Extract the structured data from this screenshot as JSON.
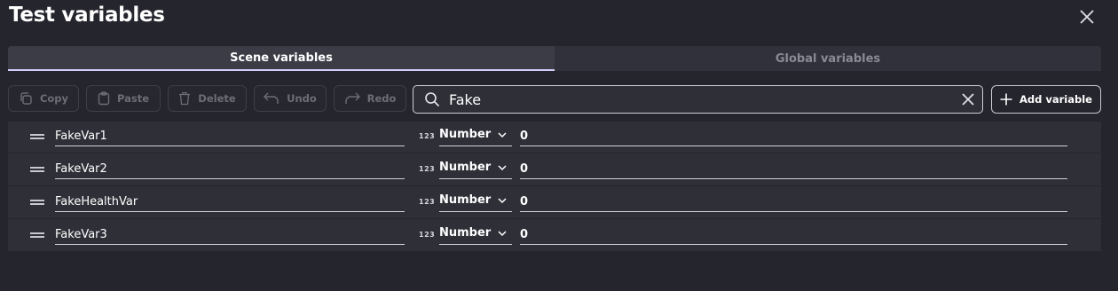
{
  "dialog": {
    "title": "Test variables"
  },
  "tabs": [
    {
      "label": "Scene variables",
      "active": true
    },
    {
      "label": "Global variables",
      "active": false
    }
  ],
  "toolbar": {
    "copy_label": "Copy",
    "paste_label": "Paste",
    "delete_label": "Delete",
    "undo_label": "Undo",
    "redo_label": "Redo",
    "add_label": "Add variable"
  },
  "search": {
    "value": "Fake"
  },
  "variables": [
    {
      "name": "FakeVar1",
      "type_icon": "123",
      "type": "Number",
      "value": "0"
    },
    {
      "name": "FakeVar2",
      "type_icon": "123",
      "type": "Number",
      "value": "0"
    },
    {
      "name": "FakeHealthVar",
      "type_icon": "123",
      "type": "Number",
      "value": "0"
    },
    {
      "name": "FakeVar3",
      "type_icon": "123",
      "type": "Number",
      "value": "0"
    }
  ],
  "colors": {
    "background": "#25252d",
    "panel": "#2f2f38",
    "tab_accent": "#d7cdfb",
    "disabled_text": "#6d6d78"
  },
  "icons": {
    "close": "close-icon",
    "copy": "copy-icon",
    "paste": "clipboard-icon",
    "delete": "trash-icon",
    "undo": "undo-icon",
    "redo": "redo-icon",
    "search": "search-icon",
    "clear": "clear-icon",
    "add": "plus-icon",
    "drag": "drag-handle-icon",
    "dropdown": "chevron-down-icon"
  }
}
